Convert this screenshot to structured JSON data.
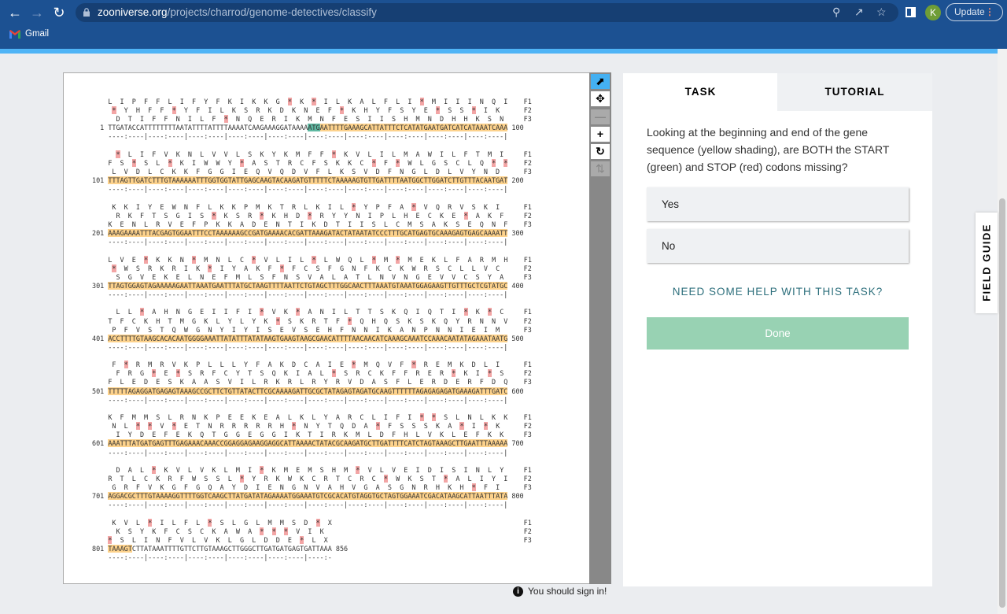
{
  "browser": {
    "url_host": "zooniverse.org",
    "url_path": "/projects/charrod/genome-detectives/classify",
    "avatar_initial": "K",
    "update_label": "Update",
    "bookmark_gmail": "Gmail"
  },
  "colors": {
    "stop": "#f3a5a5",
    "gene": "#fdd28c",
    "start_codon": "#5fb9a2",
    "done": "#98d2b3",
    "help_link": "#2d6f7c"
  },
  "sequence": {
    "frame_labels": [
      "F1",
      "F2",
      "F3"
    ],
    "start_codon": [
      51,
      53
    ],
    "gene_region": [
      51,
      806
    ],
    "blocks": [
      {
        "start": 1,
        "end": 100,
        "dna": "TTGATACCATTTTTTTTAATATTTTATTTTAAAATCAAGAAAGGATAAAAATGAATTTTGAAAGCATTATTTCTCATATGAATGATCATCATAAATCAAA",
        "frames": [
          "LIPFFLIFYFKIKKG*K*ILKALFLI*MIIINQI",
          "*YHFF*YFILKSRKDKNEF*KHYFSYE*SS*IK",
          "DTIFFNILF*NQERIKMNFESIISHMNDHHKSN"
        ]
      },
      {
        "start": 101,
        "end": 200,
        "dna": "TTTAGTTGATCTTTGTAAAAAATTTGGTGGTATTGAGCAAGTACAAGATGTTTTTCTAAAAAGTGTTGATTTTAATGGCTTGGATCTTGTTTACAATGAT",
        "frames": [
          "*LIFVKNLVVLSKYKMFF*KVLILMAWILFTMI",
          "FS*SL*KIWWY*ASTRCFSKKC*F*WLGSCLQ**",
          "LVDLCKKFGGIEQVQDVFLKSVDFNGLDLVYND"
        ]
      },
      {
        "start": 201,
        "end": 300,
        "dna": "AAAGAAAATTTACGAGTGGAATTTCCTAAAAAAGCCGATGAAAACACGATTAAAGATACTATAATATCCCTTTGCATGAGTGCAAAGAGTGAGCAAAATT",
        "frames": [
          "KKIYEWNFLKKPMKTRLKIL*YPFA*VQRVSKI",
          "RKFTSGIS*KSR*KHD*RYYNIPLHECKE*AKF",
          "KENLRVEFPKKADENTIKDTIISLCMSAKSEQNF"
        ]
      },
      {
        "start": 301,
        "end": 400,
        "dna": "TTAGTGGAGTAGAAAAAGAATTAAATGAATTTATGCTAAGTTTTAATTCTGTAGCTTTGGCAACTTTAAATGTAAATGGAGAAGTTGTTTGCTCGTATGC",
        "frames": [
          "LVE*KKN*MNLC*VLIL*LWQL*M*MEKLFARMH",
          "*WSRKRIK*IYAKF*FCSFGNFKCKWRSCLLVC",
          "SGVEKELNEFMLSFNSVALATLNVNGEVVCSYA"
        ]
      },
      {
        "start": 401,
        "end": 500,
        "dna": "ACCTTTTGTAAGCACACAATGGGGAAATTATATTTATATAAGTGAAGTAAGCGAACATTTTAACAACATCAAAGCAAATCCAAACAATATAGAAATAATG",
        "frames": [
          "LL*AHNGEIIFI*VK*ANILTTSKQIQTI*K*C",
          "TFCKHTMGKLYLYK*SKRTF*QHQSKSKQYRNNV",
          "PFVSTQWGNYIYISEVSEHFNNIKANPNNIEIM"
        ]
      },
      {
        "start": 501,
        "end": 600,
        "dna": "TTTTTAGAGGATGAGAGTAAAGCCGCTTCTGTTATACTTCGCAAAAGATTGCGCTATAGAGTAGATGCAAGTTTTTTAGAGAGAGATGAAAGATTTGATC",
        "frames": [
          "F*RMRVKPLLLYFAKDCAIE*MQVF*REMKDLI",
          "FRG*E*SRFCYTSQKIAL*SRCKFFRER*KI*S",
          "FLEDESKAASVILRKRLRYRVDASFLERDERFDQ"
        ]
      },
      {
        "start": 601,
        "end": 700,
        "dna": "AAATTTATGATGAGTTTGAGAAACAAACCGGAGGAGAAGGAGGCATTAAAACTATACGCAAGATGCTTGATTTTCATCTAGTAAAGCTTGAATTTAAAAA",
        "frames": [
          "KFMMSLRNKPEEKEALKLYARCLIFI**SLNLKK",
          "NL**V*ETNRRRRRH*NYTQDA*FSSSKA*I*K",
          "IYDEFEKQTGGEGGIKTIRKMLDFHLVKLEFKK"
        ]
      },
      {
        "start": 701,
        "end": 800,
        "dna": "AGGACGCTTTGTAAAAGGTTTTGGTCAAGCTTATGATATAGAAAATGGAAATGTCGCACATGTAGGTGCTAGTGGAAATCGACATAAGCATTAATTTATA",
        "frames": [
          "DAL*KVLVKLMI*KMEMSHM*VLVEIDISINLY",
          "RTLCKRFWSSL*YRKWKCRTCRC*WKST*ALIYI",
          "GRFVKGFGQAYDIENGNVAHVGASGNRHKH*FI"
        ]
      },
      {
        "start": 801,
        "end": 856,
        "dna": "TAAAGTCTTATAAATTTTGTTCTTGTAAAGCTTGGGCTTGATGATGAGTGATTAAA",
        "frames": [
          "KVL*ILFL*SLGLMMSD*X",
          "KSYKFCSCKAWA***VIK",
          "*SLINFVLVKLGLDDE*LX"
        ]
      }
    ]
  },
  "task_panel": {
    "tabs": [
      {
        "label": "TASK",
        "active": true
      },
      {
        "label": "TUTORIAL",
        "active": false
      }
    ],
    "question": "Looking at the beginning and end of the gene sequence (yellow shading), are BOTH the START (green) and STOP (red) codons missing?",
    "answers": [
      "Yes",
      "No"
    ],
    "help_link": "NEED SOME HELP WITH THIS TASK?",
    "done_label": "Done"
  },
  "field_guide_label": "FIELD GUIDE",
  "sign_in_notice": "You should sign in!"
}
